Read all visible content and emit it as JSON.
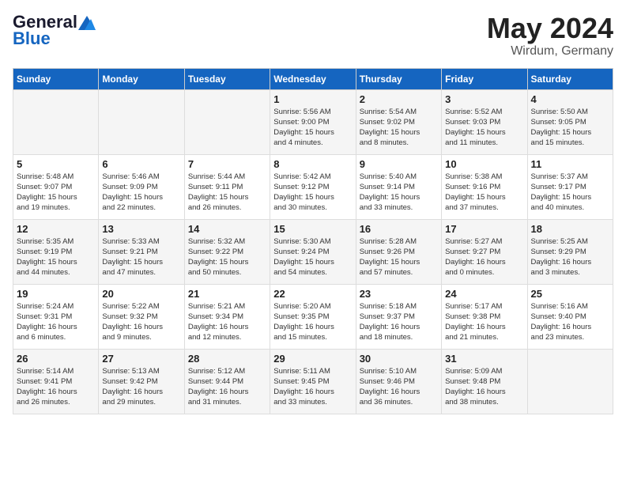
{
  "header": {
    "logo_line1": "General",
    "logo_line2": "Blue",
    "month": "May 2024",
    "location": "Wirdum, Germany"
  },
  "days_of_week": [
    "Sunday",
    "Monday",
    "Tuesday",
    "Wednesday",
    "Thursday",
    "Friday",
    "Saturday"
  ],
  "weeks": [
    [
      {
        "day": "",
        "info": ""
      },
      {
        "day": "",
        "info": ""
      },
      {
        "day": "",
        "info": ""
      },
      {
        "day": "1",
        "info": "Sunrise: 5:56 AM\nSunset: 9:00 PM\nDaylight: 15 hours\nand 4 minutes."
      },
      {
        "day": "2",
        "info": "Sunrise: 5:54 AM\nSunset: 9:02 PM\nDaylight: 15 hours\nand 8 minutes."
      },
      {
        "day": "3",
        "info": "Sunrise: 5:52 AM\nSunset: 9:03 PM\nDaylight: 15 hours\nand 11 minutes."
      },
      {
        "day": "4",
        "info": "Sunrise: 5:50 AM\nSunset: 9:05 PM\nDaylight: 15 hours\nand 15 minutes."
      }
    ],
    [
      {
        "day": "5",
        "info": "Sunrise: 5:48 AM\nSunset: 9:07 PM\nDaylight: 15 hours\nand 19 minutes."
      },
      {
        "day": "6",
        "info": "Sunrise: 5:46 AM\nSunset: 9:09 PM\nDaylight: 15 hours\nand 22 minutes."
      },
      {
        "day": "7",
        "info": "Sunrise: 5:44 AM\nSunset: 9:11 PM\nDaylight: 15 hours\nand 26 minutes."
      },
      {
        "day": "8",
        "info": "Sunrise: 5:42 AM\nSunset: 9:12 PM\nDaylight: 15 hours\nand 30 minutes."
      },
      {
        "day": "9",
        "info": "Sunrise: 5:40 AM\nSunset: 9:14 PM\nDaylight: 15 hours\nand 33 minutes."
      },
      {
        "day": "10",
        "info": "Sunrise: 5:38 AM\nSunset: 9:16 PM\nDaylight: 15 hours\nand 37 minutes."
      },
      {
        "day": "11",
        "info": "Sunrise: 5:37 AM\nSunset: 9:17 PM\nDaylight: 15 hours\nand 40 minutes."
      }
    ],
    [
      {
        "day": "12",
        "info": "Sunrise: 5:35 AM\nSunset: 9:19 PM\nDaylight: 15 hours\nand 44 minutes."
      },
      {
        "day": "13",
        "info": "Sunrise: 5:33 AM\nSunset: 9:21 PM\nDaylight: 15 hours\nand 47 minutes."
      },
      {
        "day": "14",
        "info": "Sunrise: 5:32 AM\nSunset: 9:22 PM\nDaylight: 15 hours\nand 50 minutes."
      },
      {
        "day": "15",
        "info": "Sunrise: 5:30 AM\nSunset: 9:24 PM\nDaylight: 15 hours\nand 54 minutes."
      },
      {
        "day": "16",
        "info": "Sunrise: 5:28 AM\nSunset: 9:26 PM\nDaylight: 15 hours\nand 57 minutes."
      },
      {
        "day": "17",
        "info": "Sunrise: 5:27 AM\nSunset: 9:27 PM\nDaylight: 16 hours\nand 0 minutes."
      },
      {
        "day": "18",
        "info": "Sunrise: 5:25 AM\nSunset: 9:29 PM\nDaylight: 16 hours\nand 3 minutes."
      }
    ],
    [
      {
        "day": "19",
        "info": "Sunrise: 5:24 AM\nSunset: 9:31 PM\nDaylight: 16 hours\nand 6 minutes."
      },
      {
        "day": "20",
        "info": "Sunrise: 5:22 AM\nSunset: 9:32 PM\nDaylight: 16 hours\nand 9 minutes."
      },
      {
        "day": "21",
        "info": "Sunrise: 5:21 AM\nSunset: 9:34 PM\nDaylight: 16 hours\nand 12 minutes."
      },
      {
        "day": "22",
        "info": "Sunrise: 5:20 AM\nSunset: 9:35 PM\nDaylight: 16 hours\nand 15 minutes."
      },
      {
        "day": "23",
        "info": "Sunrise: 5:18 AM\nSunset: 9:37 PM\nDaylight: 16 hours\nand 18 minutes."
      },
      {
        "day": "24",
        "info": "Sunrise: 5:17 AM\nSunset: 9:38 PM\nDaylight: 16 hours\nand 21 minutes."
      },
      {
        "day": "25",
        "info": "Sunrise: 5:16 AM\nSunset: 9:40 PM\nDaylight: 16 hours\nand 23 minutes."
      }
    ],
    [
      {
        "day": "26",
        "info": "Sunrise: 5:14 AM\nSunset: 9:41 PM\nDaylight: 16 hours\nand 26 minutes."
      },
      {
        "day": "27",
        "info": "Sunrise: 5:13 AM\nSunset: 9:42 PM\nDaylight: 16 hours\nand 29 minutes."
      },
      {
        "day": "28",
        "info": "Sunrise: 5:12 AM\nSunset: 9:44 PM\nDaylight: 16 hours\nand 31 minutes."
      },
      {
        "day": "29",
        "info": "Sunrise: 5:11 AM\nSunset: 9:45 PM\nDaylight: 16 hours\nand 33 minutes."
      },
      {
        "day": "30",
        "info": "Sunrise: 5:10 AM\nSunset: 9:46 PM\nDaylight: 16 hours\nand 36 minutes."
      },
      {
        "day": "31",
        "info": "Sunrise: 5:09 AM\nSunset: 9:48 PM\nDaylight: 16 hours\nand 38 minutes."
      },
      {
        "day": "",
        "info": ""
      }
    ]
  ]
}
